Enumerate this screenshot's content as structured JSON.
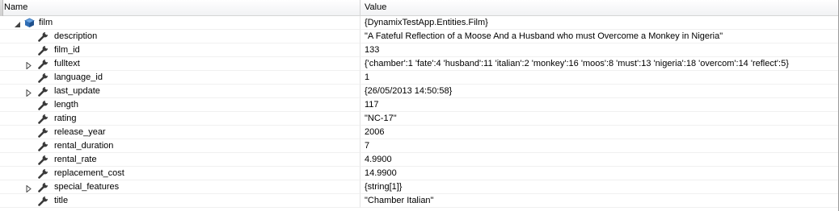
{
  "header": {
    "name_label": "Name",
    "value_label": "Value"
  },
  "rows": [
    {
      "name": "film",
      "value": "{DynamixTestApp.Entities.Film}",
      "level": 0,
      "expander": "expanded",
      "icon": "object-icon"
    },
    {
      "name": "description",
      "value": "\"A Fateful Reflection of a Moose And a Husband who must Overcome a Monkey in Nigeria\"",
      "level": 1,
      "expander": "none",
      "icon": "property-wrench-icon"
    },
    {
      "name": "film_id",
      "value": "133",
      "level": 1,
      "expander": "none",
      "icon": "property-wrench-icon"
    },
    {
      "name": "fulltext",
      "value": "{'chamber':1 'fate':4 'husband':11 'italian':2 'monkey':16 'moos':8 'must':13 'nigeria':18 'overcom':14 'reflect':5}",
      "level": 1,
      "expander": "collapsed",
      "icon": "property-wrench-icon"
    },
    {
      "name": "language_id",
      "value": "1",
      "level": 1,
      "expander": "none",
      "icon": "property-wrench-icon"
    },
    {
      "name": "last_update",
      "value": "{26/05/2013 14:50:58}",
      "level": 1,
      "expander": "collapsed",
      "icon": "property-wrench-icon"
    },
    {
      "name": "length",
      "value": "117",
      "level": 1,
      "expander": "none",
      "icon": "property-wrench-icon"
    },
    {
      "name": "rating",
      "value": "\"NC-17\"",
      "level": 1,
      "expander": "none",
      "icon": "property-wrench-icon"
    },
    {
      "name": "release_year",
      "value": "2006",
      "level": 1,
      "expander": "none",
      "icon": "property-wrench-icon"
    },
    {
      "name": "rental_duration",
      "value": "7",
      "level": 1,
      "expander": "none",
      "icon": "property-wrench-icon"
    },
    {
      "name": "rental_rate",
      "value": "4.9900",
      "level": 1,
      "expander": "none",
      "icon": "property-wrench-icon"
    },
    {
      "name": "replacement_cost",
      "value": "14.9900",
      "level": 1,
      "expander": "none",
      "icon": "property-wrench-icon"
    },
    {
      "name": "special_features",
      "value": "{string[1]}",
      "level": 1,
      "expander": "collapsed",
      "icon": "property-wrench-icon"
    },
    {
      "name": "title",
      "value": "\"Chamber Italian\"",
      "level": 1,
      "expander": "none",
      "icon": "property-wrench-icon"
    }
  ],
  "colors": {
    "object_icon": "#2f6db5",
    "wrench_icon": "#3a3a3a",
    "expander": "#444444"
  }
}
